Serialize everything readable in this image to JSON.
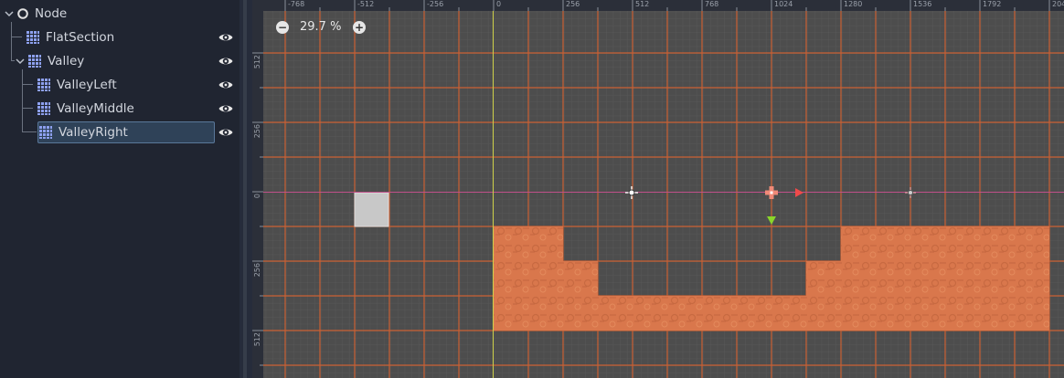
{
  "scene_tree": {
    "nodes": [
      {
        "label": "Node",
        "icon": "node-circle-icon",
        "visible_toggle": false
      },
      {
        "label": "FlatSection",
        "icon": "tilemap-icon",
        "visible_toggle": true
      },
      {
        "label": "Valley",
        "icon": "tilemap-icon",
        "visible_toggle": true,
        "expanded": true
      },
      {
        "label": "ValleyLeft",
        "icon": "tilemap-icon",
        "visible_toggle": true
      },
      {
        "label": "ValleyMiddle",
        "icon": "tilemap-icon",
        "visible_toggle": true
      },
      {
        "label": "ValleyRight",
        "icon": "tilemap-icon",
        "visible_toggle": true,
        "selected": true
      }
    ]
  },
  "viewport": {
    "zoom_label": "29.7 %",
    "zoom_out_label": "−",
    "zoom_in_label": "+",
    "ruler_top_labels": [
      "-768",
      "-512",
      "-256",
      "0",
      "256",
      "512",
      "768",
      "1024",
      "1280",
      "1536",
      "1792",
      "204"
    ],
    "ruler_left_labels": [
      "512",
      "256",
      "0",
      "256",
      "512"
    ],
    "colors": {
      "grid_major": "#e0632f",
      "tile_fill": "#d9774c",
      "canvas_bg": "#4d4d4d",
      "axis_x": "#d04a8a",
      "axis_y": "#d8d850",
      "selection": "#5a789a"
    }
  }
}
